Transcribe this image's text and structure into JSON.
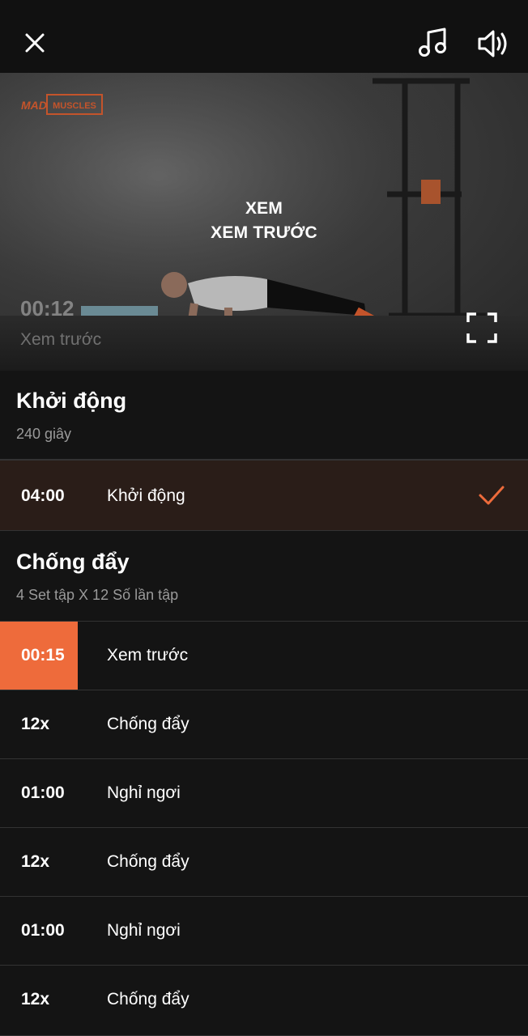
{
  "topbar": {
    "close_icon": "close-icon",
    "music_icon": "music-note-icon",
    "volume_icon": "volume-icon"
  },
  "video": {
    "brand_left": "MAD",
    "brand_right": "MUSCLES",
    "title_line1": "XEM",
    "title_line2": "XEM TRƯỚC",
    "timer": "00:12",
    "timer_label": "Xem trước",
    "fullscreen_icon": "fullscreen-icon"
  },
  "sections": [
    {
      "title": "Khởi động",
      "subtitle": "240 giây",
      "rows": [
        {
          "value": "04:00",
          "label": "Khởi động",
          "state": "done"
        }
      ]
    },
    {
      "title": "Chống đẩy",
      "subtitle": "4 Set tập X 12 Số lần tập",
      "rows": [
        {
          "value": "00:15",
          "label": "Xem trước",
          "state": "active"
        },
        {
          "value": "12x",
          "label": "Chống đẩy",
          "state": "pending"
        },
        {
          "value": "01:00",
          "label": "Nghỉ ngơi",
          "state": "pending"
        },
        {
          "value": "12x",
          "label": "Chống đẩy",
          "state": "pending"
        },
        {
          "value": "01:00",
          "label": "Nghỉ ngơi",
          "state": "pending"
        },
        {
          "value": "12x",
          "label": "Chống đẩy",
          "state": "pending"
        }
      ]
    }
  ],
  "colors": {
    "accent": "#ee6b3b",
    "background": "#141414",
    "done_row": "#2a1d18"
  }
}
